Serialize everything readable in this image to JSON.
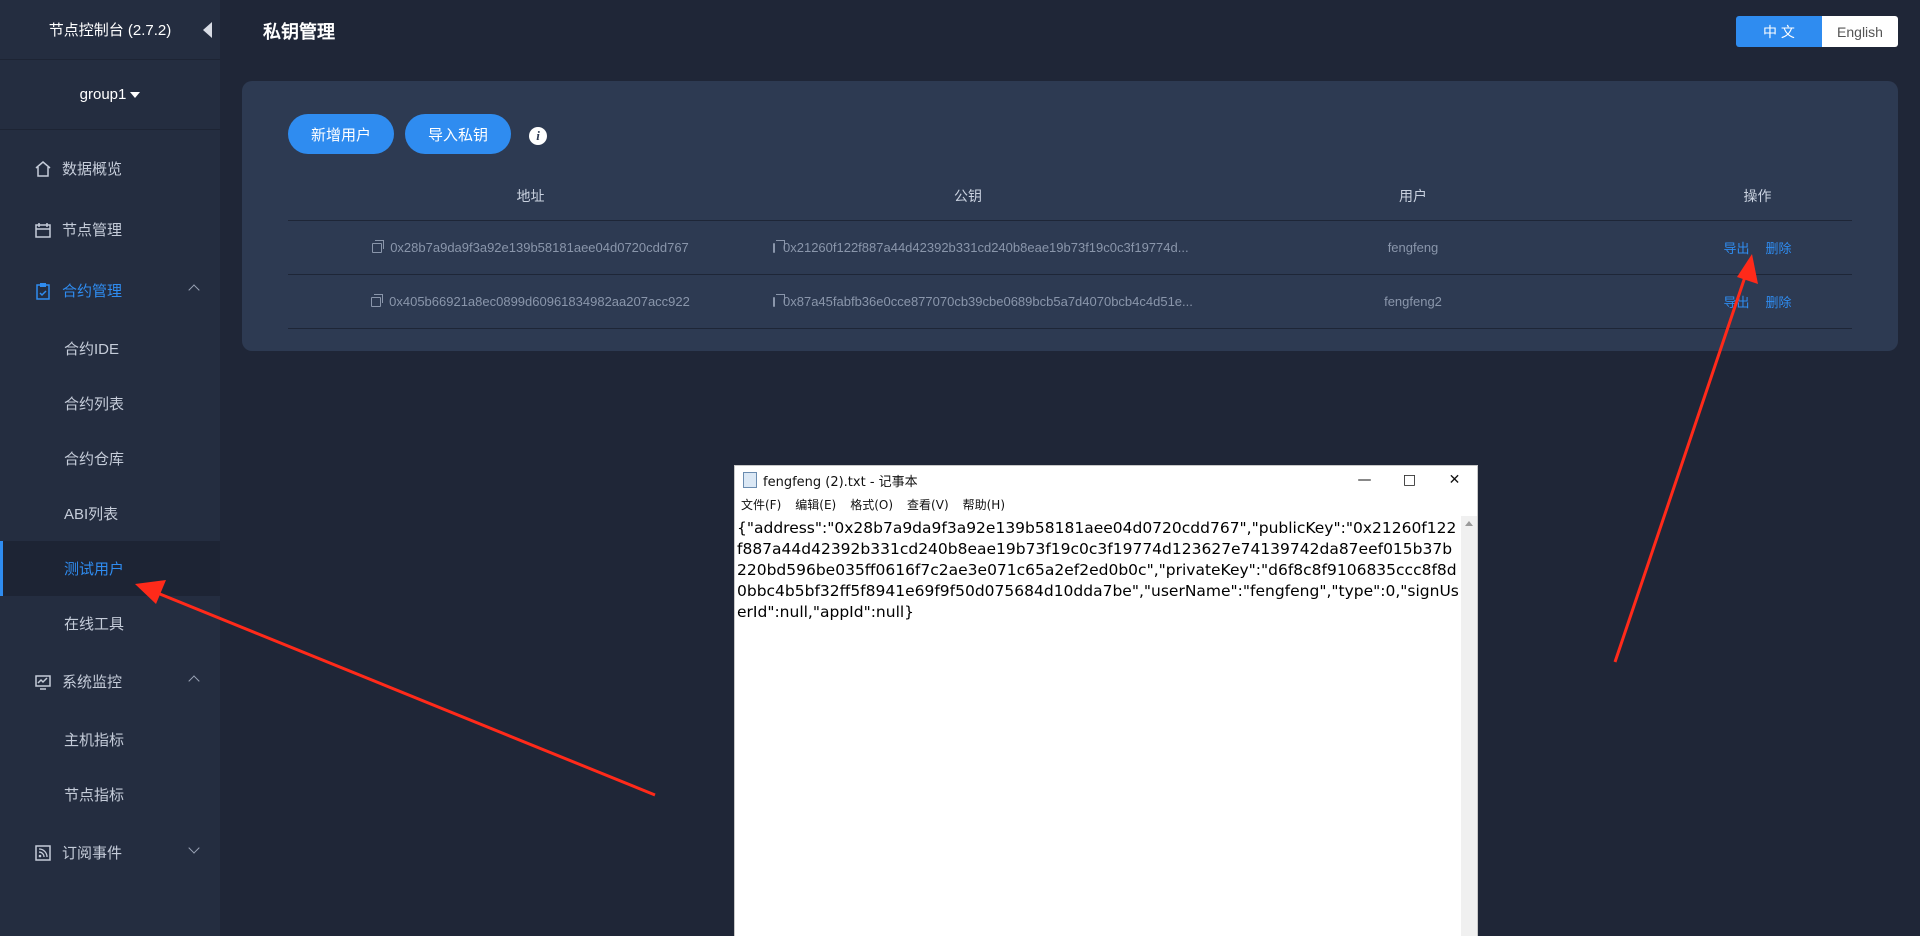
{
  "app": {
    "title": "节点控制台 (2.7.2)",
    "group": "group1"
  },
  "header": {
    "title": "私钥管理"
  },
  "lang": {
    "zh": "中 文",
    "en": "English"
  },
  "sidebar": {
    "items": [
      {
        "label": "数据概览",
        "icon": "home-icon"
      },
      {
        "label": "节点管理",
        "icon": "calendar-icon"
      },
      {
        "label": "合约管理",
        "icon": "clipboard-icon"
      },
      {
        "label": "合约IDE"
      },
      {
        "label": "合约列表"
      },
      {
        "label": "合约仓库"
      },
      {
        "label": "ABI列表"
      },
      {
        "label": "测试用户"
      },
      {
        "label": "在线工具"
      },
      {
        "label": "系统监控",
        "icon": "monitor-icon"
      },
      {
        "label": "主机指标"
      },
      {
        "label": "节点指标"
      },
      {
        "label": "订阅事件",
        "icon": "rss-icon"
      }
    ]
  },
  "toolbar": {
    "add_user": "新增用户",
    "import_key": "导入私钥",
    "info": "i"
  },
  "table": {
    "headers": [
      "地址",
      "公钥",
      "用户",
      "操作"
    ],
    "rows": [
      {
        "address": "0x28b7a9da9f3a92e139b58181aee04d0720cdd767",
        "public_key": "0x21260f122f887a44d42392b331cd240b8eae19b73f19c0c3f19774d...",
        "user": "fengfeng",
        "export": "导出",
        "delete": "删除"
      },
      {
        "address": "0x405b66921a8ec0899d60961834982aa207acc922",
        "public_key": "0x87a45fabfb36e0cce877070cb39cbe0689bcb5a7d4070bcb4c4d51e...",
        "user": "fengfeng2",
        "export": "导出",
        "delete": "删除"
      }
    ]
  },
  "notepad": {
    "title": "fengfeng (2).txt - 记事本",
    "menu": [
      "文件(F)",
      "编辑(E)",
      "格式(O)",
      "查看(V)",
      "帮助(H)"
    ],
    "content": "{\"address\":\"0x28b7a9da9f3a92e139b58181aee04d0720cdd767\",\"publicKey\":\"0x21260f122f887a44d42392b331cd240b8eae19b73f19c0c3f19774d123627e74139742da87eef015b37b220bd596be035ff0616f7c2ae3e071c65a2ef2ed0b0c\",\"privateKey\":\"d6f8c8f9106835ccc8f8d0bbc4b5bf32ff5f8941e69f9f50d075684d10dda7be\",\"userName\":\"fengfeng\",\"type\":0,\"signUserId\":null,\"appId\":null}"
  },
  "colors": {
    "accent": "#2f8cf0",
    "annotation": "#ff2a1a"
  }
}
